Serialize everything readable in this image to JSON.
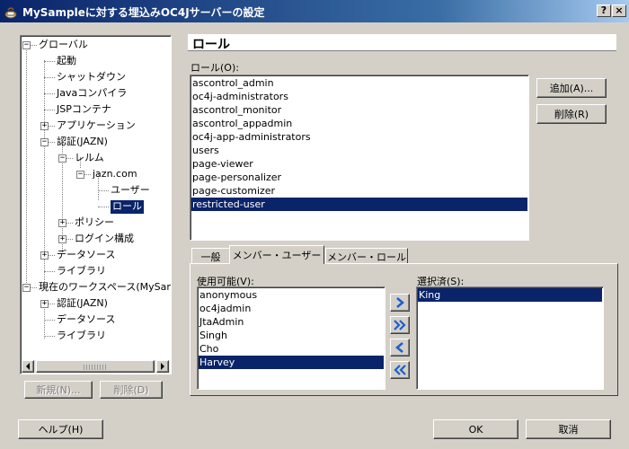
{
  "window": {
    "title": "MySampleに対する埋込みOC4Jサーバーの設定",
    "min_label": "_",
    "close_label": "×"
  },
  "tree": {
    "items": [
      {
        "label": "グローバル"
      },
      {
        "label": "起動"
      },
      {
        "label": "シャットダウン"
      },
      {
        "label": "Javaコンパイラ"
      },
      {
        "label": "JSPコンテナ"
      },
      {
        "label": "アプリケーション"
      },
      {
        "label": "認証(JAZN)"
      },
      {
        "label": "レルム"
      },
      {
        "label": "jazn.com"
      },
      {
        "label": "ユーザー"
      },
      {
        "label": "ロール"
      },
      {
        "label": "ポリシー"
      },
      {
        "label": "ログイン構成"
      },
      {
        "label": "データソース"
      },
      {
        "label": "ライブラリ"
      },
      {
        "label": "現在のワークスペース(MySamp"
      },
      {
        "label": "認証(JAZN)"
      },
      {
        "label": "データソース"
      },
      {
        "label": "ライブラリ"
      }
    ],
    "new_button": "新規(N)...",
    "delete_button": "削除(D)"
  },
  "panel": {
    "heading": "ロール",
    "roles_label": "ロール(O):",
    "roles": [
      "ascontrol_admin",
      "oc4j-administrators",
      "ascontrol_monitor",
      "ascontrol_appadmin",
      "oc4j-app-administrators",
      "users",
      "page-viewer",
      "page-personalizer",
      "page-customizer",
      "restricted-user"
    ],
    "selected_role": "restricted-user",
    "add_button": "追加(A)...",
    "delete_button": "削除(R)"
  },
  "tabs": [
    {
      "label": "一般"
    },
    {
      "label": "メンバー・ユーザー"
    },
    {
      "label": "メンバー・ロール"
    }
  ],
  "active_tab": "メンバー・ユーザー",
  "members": {
    "available_label": "使用可能(V):",
    "available": [
      "anonymous",
      "oc4jadmin",
      "JtaAdmin",
      "Singh",
      "Cho",
      "Harvey"
    ],
    "selected_available": "Harvey",
    "selected_label": "選択済(S):",
    "selected": [
      "King"
    ],
    "selected_selected": "King",
    "move_right": "移動",
    "move_all_right": "すべて移動",
    "move_left": "削除",
    "move_all_left": "すべて削除"
  },
  "footer": {
    "help_button": "ヘルプ(H)",
    "ok_button": "OK",
    "cancel_button": "取消"
  },
  "colors": {
    "selection": "#0a246a",
    "face": "#d4d0c8",
    "arrow_blue": "#1a5fd0"
  }
}
